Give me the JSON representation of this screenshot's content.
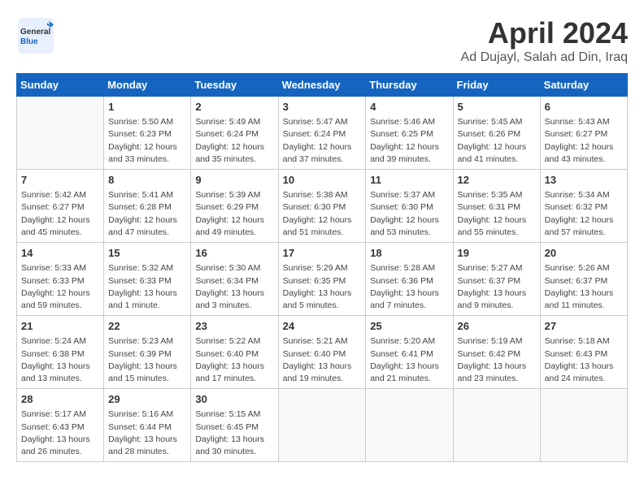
{
  "app": {
    "logo_line1": "General",
    "logo_line2": "Blue"
  },
  "header": {
    "title": "April 2024",
    "subtitle": "Ad Dujayl, Salah ad Din, Iraq"
  },
  "weekdays": [
    "Sunday",
    "Monday",
    "Tuesday",
    "Wednesday",
    "Thursday",
    "Friday",
    "Saturday"
  ],
  "weeks": [
    [
      {
        "day": "",
        "info": ""
      },
      {
        "day": "1",
        "info": "Sunrise: 5:50 AM\nSunset: 6:23 PM\nDaylight: 12 hours\nand 33 minutes."
      },
      {
        "day": "2",
        "info": "Sunrise: 5:49 AM\nSunset: 6:24 PM\nDaylight: 12 hours\nand 35 minutes."
      },
      {
        "day": "3",
        "info": "Sunrise: 5:47 AM\nSunset: 6:24 PM\nDaylight: 12 hours\nand 37 minutes."
      },
      {
        "day": "4",
        "info": "Sunrise: 5:46 AM\nSunset: 6:25 PM\nDaylight: 12 hours\nand 39 minutes."
      },
      {
        "day": "5",
        "info": "Sunrise: 5:45 AM\nSunset: 6:26 PM\nDaylight: 12 hours\nand 41 minutes."
      },
      {
        "day": "6",
        "info": "Sunrise: 5:43 AM\nSunset: 6:27 PM\nDaylight: 12 hours\nand 43 minutes."
      }
    ],
    [
      {
        "day": "7",
        "info": "Sunrise: 5:42 AM\nSunset: 6:27 PM\nDaylight: 12 hours\nand 45 minutes."
      },
      {
        "day": "8",
        "info": "Sunrise: 5:41 AM\nSunset: 6:28 PM\nDaylight: 12 hours\nand 47 minutes."
      },
      {
        "day": "9",
        "info": "Sunrise: 5:39 AM\nSunset: 6:29 PM\nDaylight: 12 hours\nand 49 minutes."
      },
      {
        "day": "10",
        "info": "Sunrise: 5:38 AM\nSunset: 6:30 PM\nDaylight: 12 hours\nand 51 minutes."
      },
      {
        "day": "11",
        "info": "Sunrise: 5:37 AM\nSunset: 6:30 PM\nDaylight: 12 hours\nand 53 minutes."
      },
      {
        "day": "12",
        "info": "Sunrise: 5:35 AM\nSunset: 6:31 PM\nDaylight: 12 hours\nand 55 minutes."
      },
      {
        "day": "13",
        "info": "Sunrise: 5:34 AM\nSunset: 6:32 PM\nDaylight: 12 hours\nand 57 minutes."
      }
    ],
    [
      {
        "day": "14",
        "info": "Sunrise: 5:33 AM\nSunset: 6:33 PM\nDaylight: 12 hours\nand 59 minutes."
      },
      {
        "day": "15",
        "info": "Sunrise: 5:32 AM\nSunset: 6:33 PM\nDaylight: 13 hours\nand 1 minute."
      },
      {
        "day": "16",
        "info": "Sunrise: 5:30 AM\nSunset: 6:34 PM\nDaylight: 13 hours\nand 3 minutes."
      },
      {
        "day": "17",
        "info": "Sunrise: 5:29 AM\nSunset: 6:35 PM\nDaylight: 13 hours\nand 5 minutes."
      },
      {
        "day": "18",
        "info": "Sunrise: 5:28 AM\nSunset: 6:36 PM\nDaylight: 13 hours\nand 7 minutes."
      },
      {
        "day": "19",
        "info": "Sunrise: 5:27 AM\nSunset: 6:37 PM\nDaylight: 13 hours\nand 9 minutes."
      },
      {
        "day": "20",
        "info": "Sunrise: 5:26 AM\nSunset: 6:37 PM\nDaylight: 13 hours\nand 11 minutes."
      }
    ],
    [
      {
        "day": "21",
        "info": "Sunrise: 5:24 AM\nSunset: 6:38 PM\nDaylight: 13 hours\nand 13 minutes."
      },
      {
        "day": "22",
        "info": "Sunrise: 5:23 AM\nSunset: 6:39 PM\nDaylight: 13 hours\nand 15 minutes."
      },
      {
        "day": "23",
        "info": "Sunrise: 5:22 AM\nSunset: 6:40 PM\nDaylight: 13 hours\nand 17 minutes."
      },
      {
        "day": "24",
        "info": "Sunrise: 5:21 AM\nSunset: 6:40 PM\nDaylight: 13 hours\nand 19 minutes."
      },
      {
        "day": "25",
        "info": "Sunrise: 5:20 AM\nSunset: 6:41 PM\nDaylight: 13 hours\nand 21 minutes."
      },
      {
        "day": "26",
        "info": "Sunrise: 5:19 AM\nSunset: 6:42 PM\nDaylight: 13 hours\nand 23 minutes."
      },
      {
        "day": "27",
        "info": "Sunrise: 5:18 AM\nSunset: 6:43 PM\nDaylight: 13 hours\nand 24 minutes."
      }
    ],
    [
      {
        "day": "28",
        "info": "Sunrise: 5:17 AM\nSunset: 6:43 PM\nDaylight: 13 hours\nand 26 minutes."
      },
      {
        "day": "29",
        "info": "Sunrise: 5:16 AM\nSunset: 6:44 PM\nDaylight: 13 hours\nand 28 minutes."
      },
      {
        "day": "30",
        "info": "Sunrise: 5:15 AM\nSunset: 6:45 PM\nDaylight: 13 hours\nand 30 minutes."
      },
      {
        "day": "",
        "info": ""
      },
      {
        "day": "",
        "info": ""
      },
      {
        "day": "",
        "info": ""
      },
      {
        "day": "",
        "info": ""
      }
    ]
  ]
}
